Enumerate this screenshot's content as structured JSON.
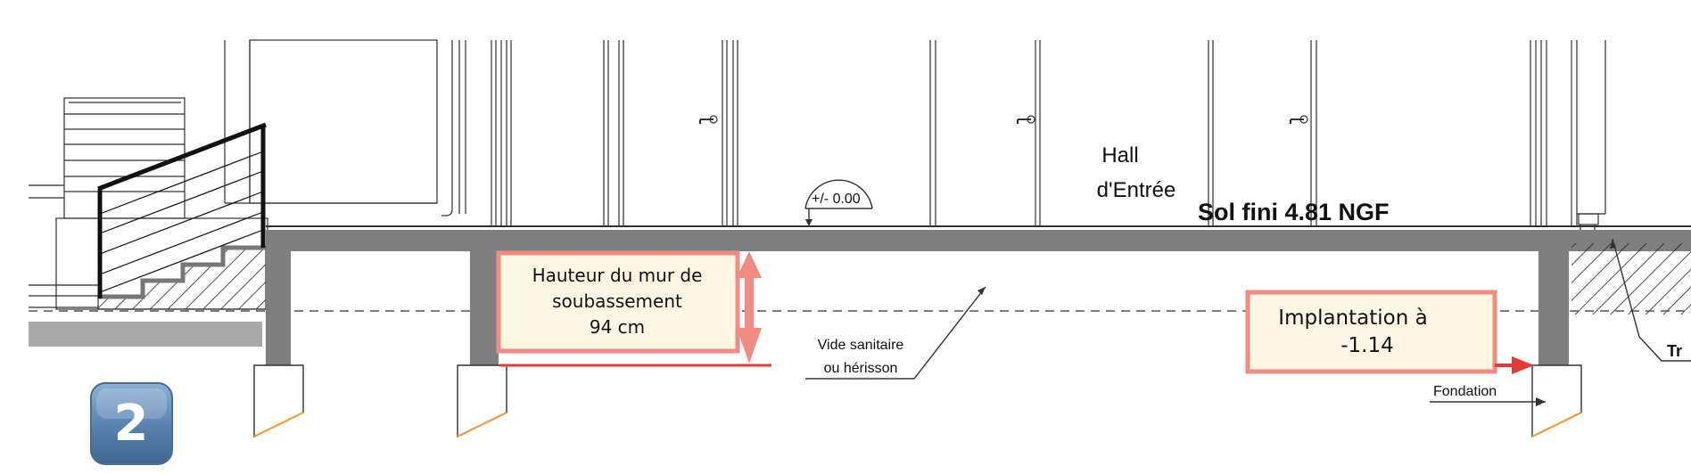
{
  "room": {
    "line1": "Hall",
    "line2": "d'Entrée"
  },
  "level_marker": "+/- 0.00",
  "floor_level": "Sol fini 4.81 NGF",
  "wall_height_callout": {
    "line1": "Hauteur du mur de",
    "line2": "soubassement",
    "line3": "94 cm"
  },
  "implantation_callout": {
    "line1": "Implantation à",
    "line2": "-1.14"
  },
  "crawl_space": {
    "line1": "Vide sanitaire",
    "line2": "ou hérisson"
  },
  "foundation_label": "Fondation",
  "cut_label": "Tr",
  "step_badge": "2",
  "colors": {
    "structure": "#7f7f7f",
    "callout_fill": "#fdf6e3",
    "callout_border": "#f28b82",
    "arrow_red": "#e53935",
    "foundation_edge": "#f0a040",
    "badge": "#5b84b1"
  }
}
